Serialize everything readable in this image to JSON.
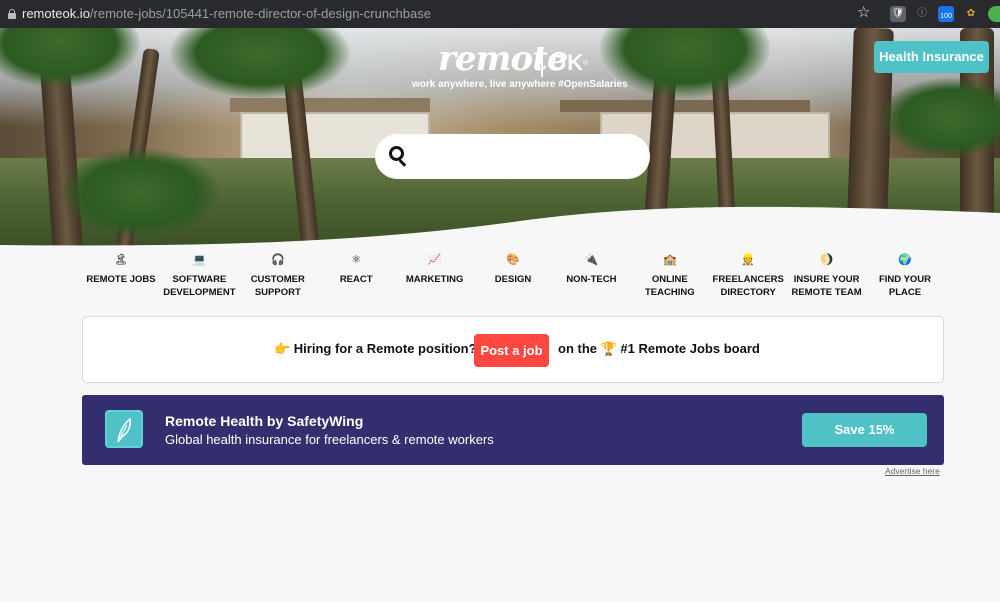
{
  "browser": {
    "url_host": "remoteok.io",
    "url_path": "/remote-jobs/105441-remote-director-of-design-crunchbase",
    "ext_badge": "100"
  },
  "header": {
    "logo_text": "remote",
    "logo_ok": "OK",
    "logo_reg": "®",
    "tagline": "work anywhere, live anywhere #OpenSalaries",
    "health_button": "Health Insurance",
    "search_placeholder": ""
  },
  "categories": [
    {
      "emoji": "🏝",
      "label": "REMOTE JOBS"
    },
    {
      "emoji": "💻",
      "label": "SOFTWARE DEVELOPMENT"
    },
    {
      "emoji": "🎧",
      "label": "CUSTOMER SUPPORT"
    },
    {
      "emoji": "⚛",
      "label": "REACT"
    },
    {
      "emoji": "📈",
      "label": "MARKETING"
    },
    {
      "emoji": "🎨",
      "label": "DESIGN"
    },
    {
      "emoji": "🔌",
      "label": "NON-TECH"
    },
    {
      "emoji": "🏫",
      "label": "ONLINE TEACHING"
    },
    {
      "emoji": "👷",
      "label": "FREELANCERS DIRECTORY"
    },
    {
      "emoji": "🌖",
      "label": "INSURE YOUR REMOTE TEAM"
    },
    {
      "emoji": "🌍",
      "label": "FIND YOUR PLACE"
    }
  ],
  "hiring": {
    "pre_text": "👉  Hiring for a Remote position?",
    "button": "Post a job",
    "post_text": "on the 🏆 #1 Remote Jobs board"
  },
  "ad": {
    "title": "Remote Health by SafetyWing",
    "subtitle": "Global health insurance for freelancers & remote workers",
    "button": "Save 15%",
    "advertise_link": "Advertise here"
  },
  "colors": {
    "accent_teal": "#4fc1c7",
    "post_red": "#ff4742",
    "ad_bg": "#332f6f"
  }
}
